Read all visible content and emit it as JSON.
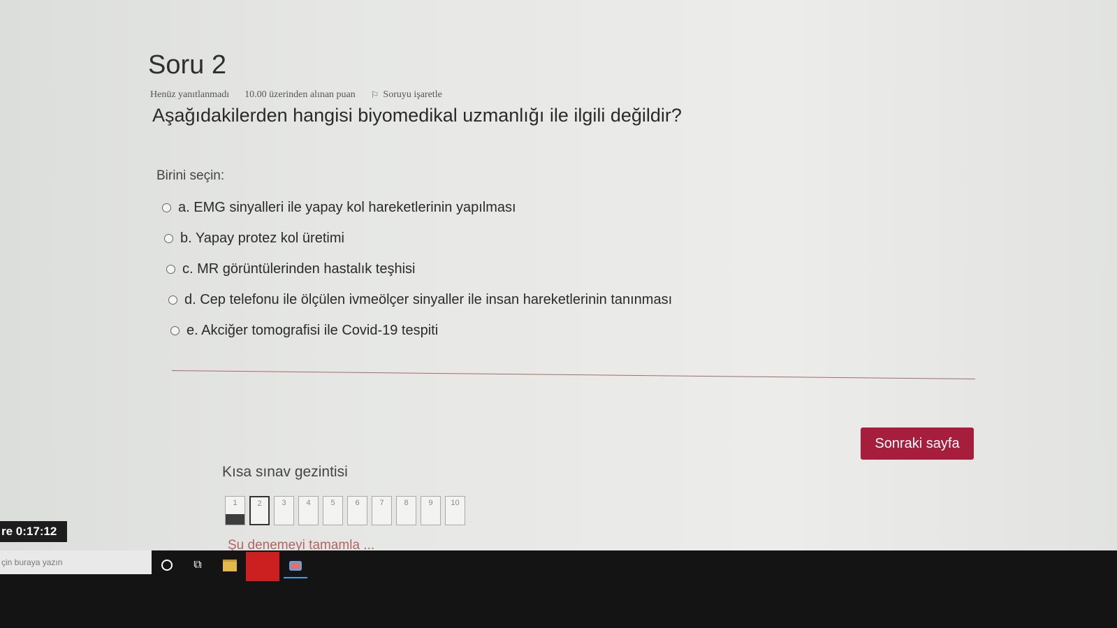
{
  "question": {
    "title": "Soru 2",
    "status": "Henüz yanıtlanmadı",
    "points": "10.00 üzerinden alınan puan",
    "flag_label": "Soruyu işaretle",
    "text": "Aşağıdakilerden hangisi biyomedikal uzmanlığı ile ilgili değildir?",
    "prompt": "Birini seçin:",
    "answers": [
      {
        "label": "a. EMG sinyalleri ile yapay kol hareketlerinin yapılması"
      },
      {
        "label": "b. Yapay protez kol üretimi"
      },
      {
        "label": "c. MR görüntülerinden hastalık teşhisi"
      },
      {
        "label": "d. Cep telefonu ile ölçülen ivmeölçer sinyaller ile insan hareketlerinin tanınması"
      },
      {
        "label": "e. Akciğer tomografisi ile Covid-19 tespiti"
      }
    ]
  },
  "next_button": "Sonraki sayfa",
  "quiz_nav": {
    "title": "Kısa sınav gezintisi",
    "buttons": [
      "1",
      "2",
      "3",
      "4",
      "5",
      "6",
      "7",
      "8",
      "9",
      "10"
    ],
    "finish_link": "Şu denemeyi tamamla ..."
  },
  "timer": "re 0:17:12",
  "taskbar": {
    "search_placeholder": "çin buraya yazın",
    "icons": [
      "cortana-icon",
      "task-view-icon",
      "file-explorer-icon",
      "red-app-icon",
      "browser-icon"
    ]
  }
}
